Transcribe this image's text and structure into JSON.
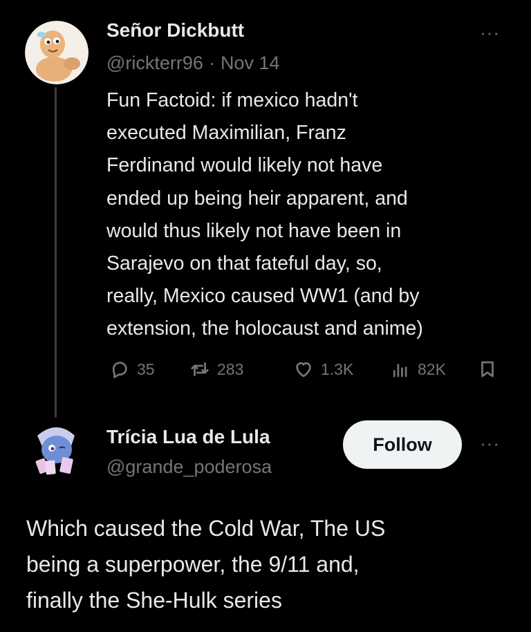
{
  "tweet": {
    "author_name": "Señor Dickbutt",
    "handle": "@rickterr96",
    "separator": "·",
    "date": "Nov 14",
    "more_label": "···",
    "text_lines": [
      "Fun Factoid: if mexico hadn't",
      "executed Maximilian, Franz",
      "Ferdinand would likely not have",
      "ended up being heir apparent, and",
      "would thus likely not have been in",
      "Sarajevo on that fateful day, so,",
      "really, Mexico caused WW1 (and by",
      "extension, the holocaust and anime)"
    ],
    "stats": {
      "replies": "35",
      "reposts": "283",
      "likes": "1.3K",
      "views": "82K"
    }
  },
  "reply": {
    "author_name": "Trícia Lua de Lula",
    "handle": "@grande_poderosa",
    "follow_label": "Follow",
    "more_label": "···",
    "text_lines": [
      "Which caused the Cold War, The US",
      "being a superpower, the 9/11 and,",
      "finally the She-Hulk series"
    ]
  },
  "icons": {
    "reply": "reply-icon",
    "repost": "repost-icon",
    "like": "heart-icon",
    "views": "views-icon",
    "bookmark": "bookmark-icon"
  },
  "colors": {
    "background": "#000000",
    "text": "#e7e9ea",
    "secondary": "#71767b",
    "follow_button": "#eff3f4"
  }
}
